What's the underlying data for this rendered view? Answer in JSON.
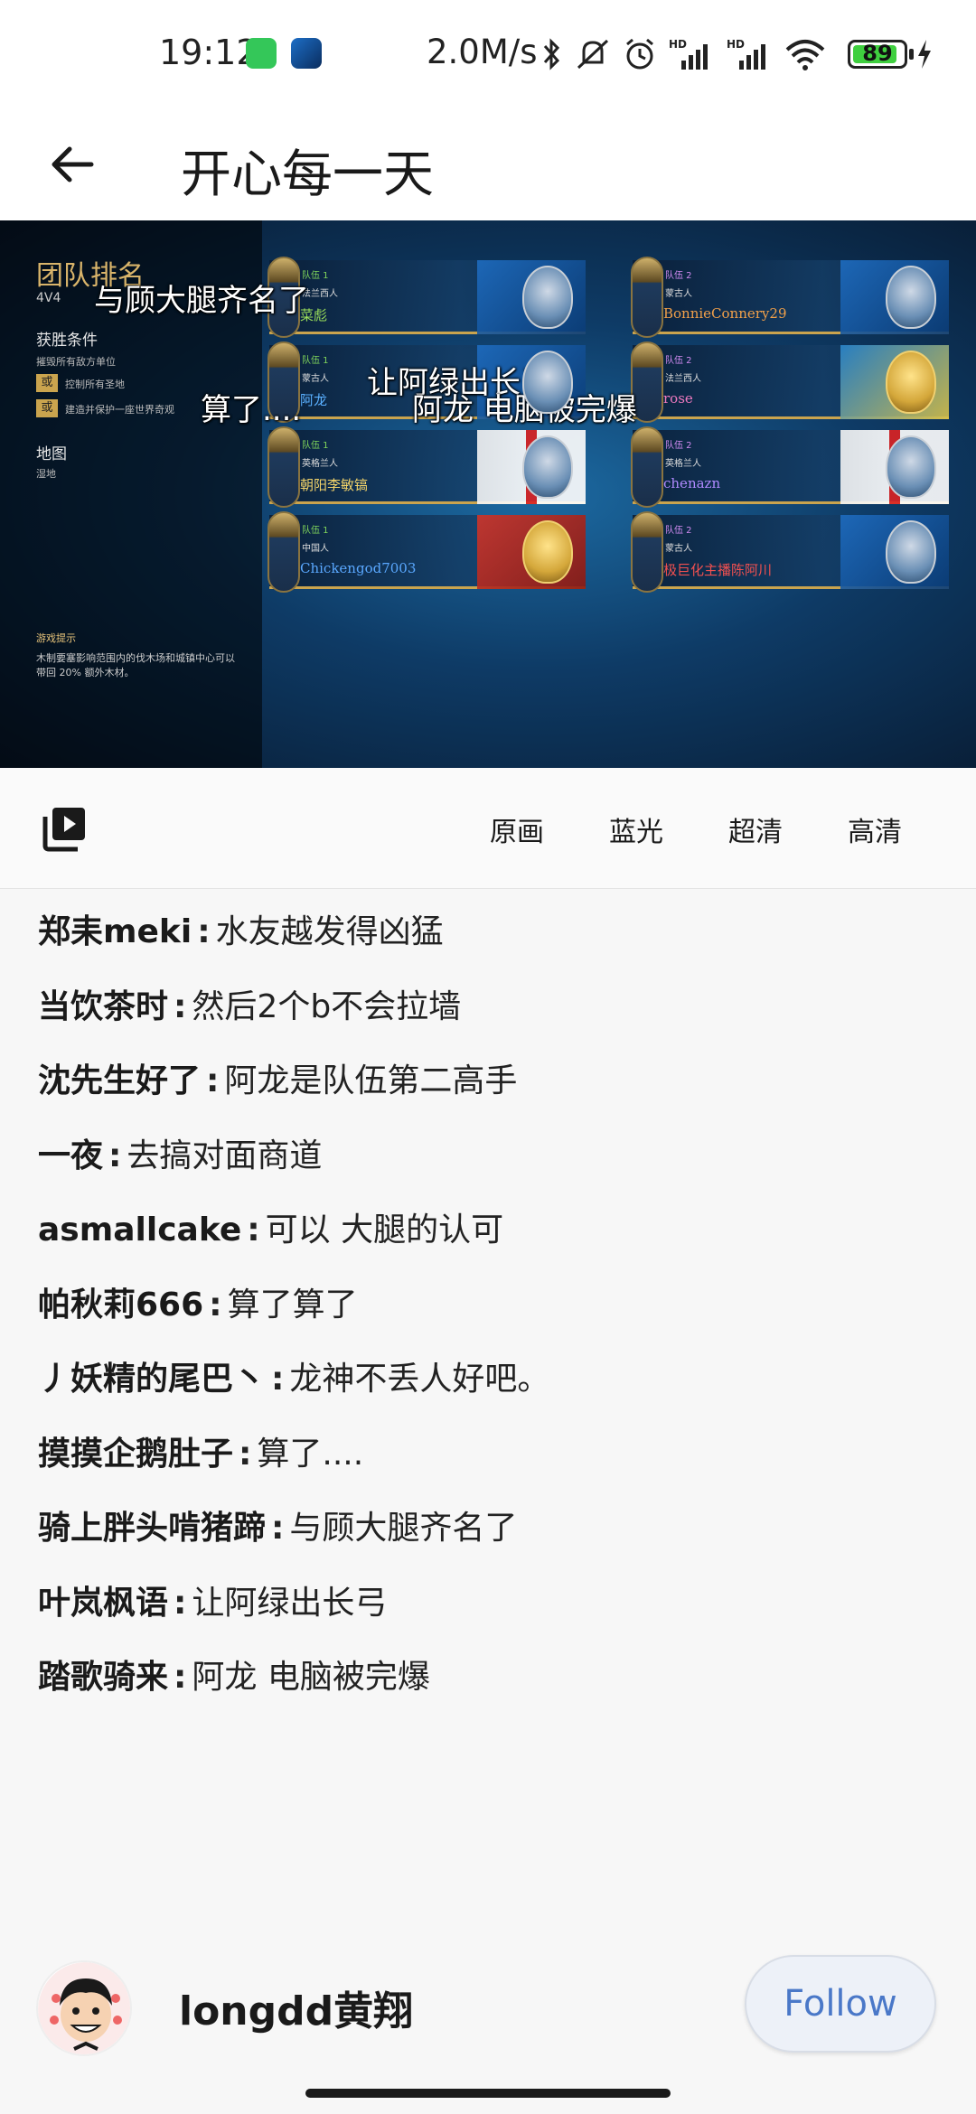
{
  "status_bar": {
    "time": "19:12",
    "network_speed": "2.0M/s",
    "battery_level": "89",
    "battery_percent": 89,
    "icons": [
      "app-icon-green",
      "app-icon-blue",
      "bluetooth-icon",
      "mute-icon",
      "alarm-icon",
      "hd-signal-icon",
      "hd-signal-icon",
      "wifi-icon",
      "battery-icon",
      "charging-icon"
    ]
  },
  "app_bar": {
    "title": "开心每一天",
    "back_icon": "arrow-left-icon"
  },
  "video": {
    "panel": {
      "title": "团队排名",
      "mode": "4V4",
      "victory_heading": "获胜条件",
      "victory_line1": "摧毁所有敌方单位",
      "victory_or1": "或",
      "victory_line2": "控制所有圣地",
      "victory_or2": "或",
      "victory_line3": "建造并保护一座世界奇观",
      "map_heading": "地图",
      "map_name": "湿地",
      "hint_title": "游戏提示",
      "hint_line1": "木制要塞影响范围内的伐木场和城镇中心可以",
      "hint_line2": "带回 20% 额外木材。"
    },
    "teams": [
      {
        "team": "队伍 1",
        "civ": "法兰西人",
        "player": "菜彪",
        "team_color": "#7fd45a",
        "name_color": "#9be05a",
        "flag": "blue"
      },
      {
        "team": "队伍 1",
        "civ": "蒙古人",
        "player": "阿龙",
        "team_color": "#7fd45a",
        "name_color": "#5ab0ff",
        "flag": "blue"
      },
      {
        "team": "队伍 1",
        "civ": "英格兰人",
        "player": "朝阳李敏镐",
        "team_color": "#7fd45a",
        "name_color": "#f2d36a",
        "flag": "white"
      },
      {
        "team": "队伍 1",
        "civ": "中国人",
        "player": "Chickengod7003",
        "team_color": "#7fd45a",
        "name_color": "#5aa8ff",
        "flag": "red"
      },
      {
        "team": "队伍 2",
        "civ": "蒙古人",
        "player": "BonnieConnery29",
        "team_color": "#d08af0",
        "name_color": "#f0a04a",
        "flag": "blue"
      },
      {
        "team": "队伍 2",
        "civ": "法兰西人",
        "player": "rose",
        "team_color": "#d08af0",
        "name_color": "#f07ac0",
        "flag": "gold"
      },
      {
        "team": "队伍 2",
        "civ": "英格兰人",
        "player": "chenazn",
        "team_color": "#d08af0",
        "name_color": "#b08aff",
        "flag": "white"
      },
      {
        "team": "队伍 2",
        "civ": "蒙古人",
        "player": "极巨化主播陈阿川",
        "team_color": "#d08af0",
        "name_color": "#f05050",
        "flag": "blue"
      }
    ],
    "danmaku": [
      {
        "text": "与顾大腿齐名了"
      },
      {
        "text": "让阿绿出长弓"
      },
      {
        "text": "算了...."
      },
      {
        "text": "阿龙 电脑被完爆"
      }
    ]
  },
  "quality": {
    "playlist_icon": "video-playlist-icon",
    "options": [
      "原画",
      "蓝光",
      "超清",
      "高清"
    ]
  },
  "comments": [
    {
      "user": "郑耒meki",
      "text": "水友越发得凶猛"
    },
    {
      "user": "当饮茶时",
      "text": "然后2个b不会拉墙"
    },
    {
      "user": "沈先生好了",
      "text": "阿龙是队伍第二高手"
    },
    {
      "user": "一夜",
      "text": "去搞对面商道"
    },
    {
      "user": "asmallcake",
      "text": "可以 大腿的认可"
    },
    {
      "user": "帕秋莉666",
      "text": "算了算了"
    },
    {
      "user": "丿妖精的尾巴丶",
      "text": "龙神不丢人好吧。"
    },
    {
      "user": "摸摸企鹅肚子",
      "text": "算了...."
    },
    {
      "user": "骑上胖头啃猪蹄",
      "text": "与顾大腿齐名了"
    },
    {
      "user": "叶岚枫语",
      "text": "让阿绿出长弓"
    },
    {
      "user": "踏歌骑来",
      "text": "阿龙 电脑被完爆"
    }
  ],
  "author": {
    "name": "longdd黄翔",
    "avatar_icon": "cartoon-avatar",
    "follow_label": "Follow"
  },
  "colors": {
    "follow_text": "#4a78c8",
    "follow_bg": "#edf1f8",
    "panel_gold": "#d9b46a"
  }
}
